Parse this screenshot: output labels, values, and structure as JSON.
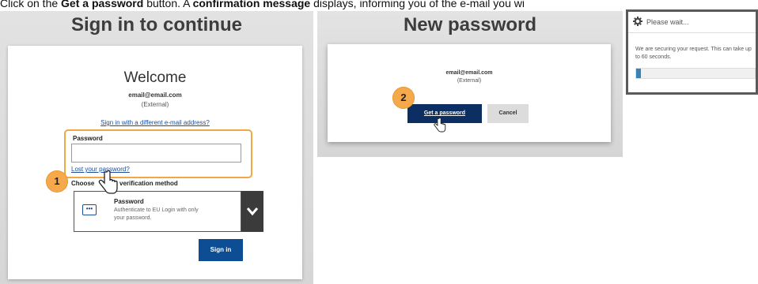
{
  "caption": {
    "part1": "Click on the ",
    "bold1": "Get a password",
    "part2": " button. A ",
    "bold2": "confirmation message",
    "part3": " displays, informing you of the e-mail you wi"
  },
  "sign_in": {
    "heading": "Sign in to continue",
    "welcome": "Welcome",
    "email": "email@email.com",
    "account_type": "(External)",
    "different_email_link": "Sign in with a different e-mail address?",
    "password_label": "Password",
    "password_value": "",
    "lost_password_link": "Lost your password?",
    "choose_method_label_part1": "Choose",
    "choose_method_label_part2": "verification method",
    "method_title": "Password",
    "method_description": "Authenticate to EU Login with only your password.",
    "method_icon": "password-dots-icon",
    "dropdown_icon": "chevron-down-icon",
    "sign_in_button": "Sign in",
    "step_badge": "1"
  },
  "new_password": {
    "heading": "New password",
    "email": "email@email.com",
    "account_type": "(External)",
    "get_password_button": "Get a password",
    "cancel_button": "Cancel",
    "step_badge": "2"
  },
  "wait_dialog": {
    "title": "Please wait...",
    "icon": "gear-icon",
    "message": "We are securing your request. This can take up to 60 seconds.",
    "progress": 0.04
  },
  "colors": {
    "highlight": "#f0a844",
    "badge": "#f5a94a",
    "primary_button": "#0d4d94",
    "get_password_button": "#0b2f63",
    "progress": "#3b82b4"
  }
}
